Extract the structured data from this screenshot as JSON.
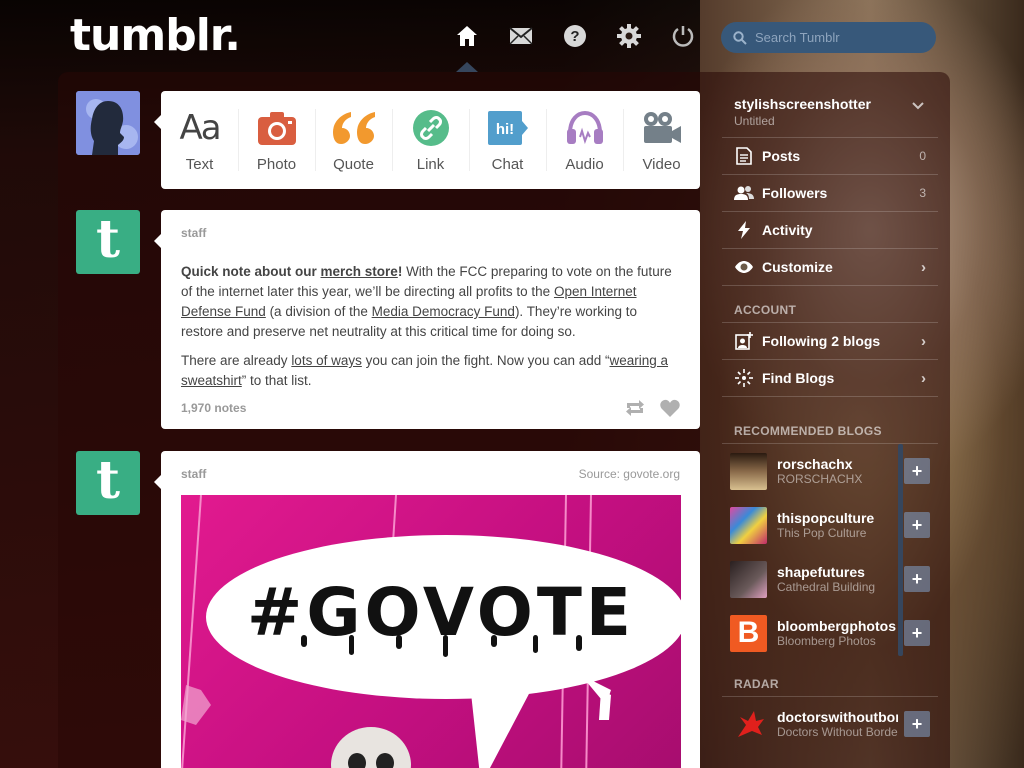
{
  "header": {
    "logo": "tumblr.",
    "nav": [
      "home-icon",
      "mail-icon",
      "help-icon",
      "gear-icon",
      "power-icon"
    ],
    "search_placeholder": "Search Tumblr"
  },
  "post_types": [
    {
      "label": "Text",
      "icon": "text-icon",
      "color": "#444444",
      "glyph": "Aa"
    },
    {
      "label": "Photo",
      "icon": "camera-icon",
      "color": "#d95e40"
    },
    {
      "label": "Quote",
      "icon": "quote-icon",
      "color": "#f2992e"
    },
    {
      "label": "Link",
      "icon": "link-icon",
      "color": "#56bc8a"
    },
    {
      "label": "Chat",
      "icon": "chat-icon",
      "color": "#529ecc",
      "glyph": "hi!"
    },
    {
      "label": "Audio",
      "icon": "headphones-icon",
      "color": "#a77dc2"
    },
    {
      "label": "Video",
      "icon": "video-icon",
      "color": "#748089"
    }
  ],
  "post1": {
    "blog": "staff",
    "p1_pre": "Quick note about our ",
    "p1_link": "merch store",
    "p1_bang": "!",
    "p1_a": " With the FCC preparing to vote on the future of the internet later this year, we’ll be directing all profits to the ",
    "p1_link2": "Open Internet Defense Fund",
    "p1_b": " (a division of the ",
    "p1_link3": "Media Democracy Fund",
    "p1_c": "). They’re working to restore and preserve net neutrality at this critical time for doing so.",
    "p2_a": "There are already ",
    "p2_link": "lots of ways",
    "p2_b": " you can join the fight. Now you can add “",
    "p2_link2": "wearing a sweatshirt",
    "p2_c": "” to that list.",
    "notes": "1,970 notes"
  },
  "post2": {
    "blog": "staff",
    "source": "Source: govote.org",
    "photo_text": "#GOVOTE"
  },
  "sidebar": {
    "blog_name": "stylishscreenshotter",
    "blog_sub": "Untitled",
    "items": [
      {
        "label": "Posts",
        "count": "0",
        "icon": "posts-icon"
      },
      {
        "label": "Followers",
        "count": "3",
        "icon": "followers-icon"
      },
      {
        "label": "Activity",
        "count": "",
        "icon": "activity-icon"
      },
      {
        "label": "Customize",
        "count": "",
        "icon": "customize-icon"
      }
    ],
    "account_heading": "ACCOUNT",
    "account_items": [
      {
        "label": "Following 2 blogs",
        "icon": "following-icon"
      },
      {
        "label": "Find Blogs",
        "icon": "find-blogs-icon"
      }
    ],
    "recommended_heading": "RECOMMENDED BLOGS",
    "recommended": [
      {
        "name": "rorschachx",
        "sub": "RORSCHACHX",
        "color": "#5a3a2a"
      },
      {
        "name": "thispopculture",
        "sub": "This Pop Culture",
        "color": "#c84fa0"
      },
      {
        "name": "shapefutures",
        "sub": "Cathedral Building",
        "color": "#4a3a3a"
      },
      {
        "name": "bloombergphotos",
        "sub": "Bloomberg Photos",
        "color": "#f05a22"
      }
    ],
    "radar_heading": "RADAR",
    "radar": {
      "name": "doctorswithoutbord",
      "sub": "Doctors Without Borde"
    }
  }
}
